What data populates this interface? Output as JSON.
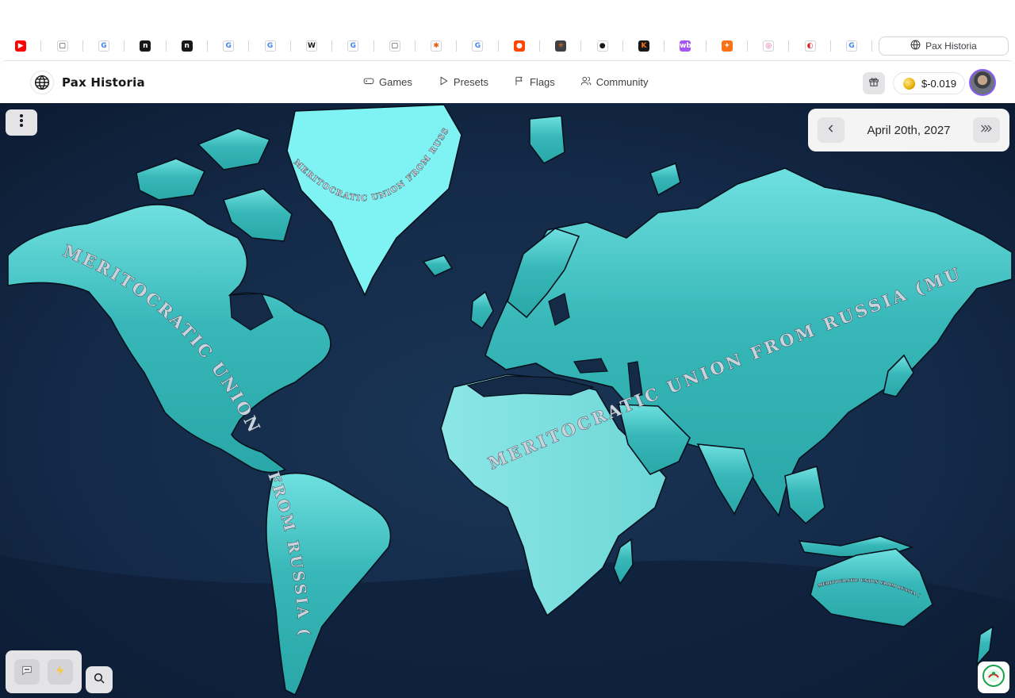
{
  "browser": {
    "tabs": [
      {
        "icon": "youtube-icon",
        "glyph": "▶",
        "bg": "#ff0000",
        "fg": "#ffffff"
      },
      {
        "icon": "app-square-icon",
        "glyph": "▢",
        "bg": "#ffffff",
        "fg": "#18181b"
      },
      {
        "icon": "google-icon",
        "glyph": "G",
        "bg": "#ffffff",
        "fg": "#4285f4"
      },
      {
        "icon": "n-logo-icon",
        "glyph": "n",
        "bg": "#18181b",
        "fg": "#ffffff"
      },
      {
        "icon": "n-logo-icon",
        "glyph": "n",
        "bg": "#18181b",
        "fg": "#ffffff"
      },
      {
        "icon": "google-icon",
        "glyph": "G",
        "bg": "#ffffff",
        "fg": "#4285f4"
      },
      {
        "icon": "google-icon",
        "glyph": "G",
        "bg": "#ffffff",
        "fg": "#4285f4"
      },
      {
        "icon": "wikipedia-icon",
        "glyph": "W",
        "bg": "#ffffff",
        "fg": "#18181b"
      },
      {
        "icon": "google-icon",
        "glyph": "G",
        "bg": "#ffffff",
        "fg": "#4285f4"
      },
      {
        "icon": "app-square-icon",
        "glyph": "▢",
        "bg": "#ffffff",
        "fg": "#18181b"
      },
      {
        "icon": "bug-icon",
        "glyph": "✱",
        "bg": "#ffffff",
        "fg": "#ea580c"
      },
      {
        "icon": "google-icon",
        "glyph": "G",
        "bg": "#ffffff",
        "fg": "#4285f4"
      },
      {
        "icon": "reddit-icon",
        "glyph": "●",
        "bg": "#ff4500",
        "fg": "#ffffff"
      },
      {
        "icon": "asterisk-icon",
        "glyph": "✳",
        "bg": "#3f3f46",
        "fg": "#f97316"
      },
      {
        "icon": "github-icon",
        "glyph": "●",
        "bg": "#ffffff",
        "fg": "#18181b"
      },
      {
        "icon": "k-logo-icon",
        "glyph": "K",
        "bg": "#18181b",
        "fg": "#f97316"
      },
      {
        "icon": "wb-logo-icon",
        "glyph": "wb",
        "bg": "#a855f7",
        "fg": "#ffffff"
      },
      {
        "icon": "bolt-app-icon",
        "glyph": "✦",
        "bg": "#f97316",
        "fg": "#ffffff"
      },
      {
        "icon": "pink-circle-icon",
        "glyph": "◎",
        "bg": "#ffffff",
        "fg": "#ec4899"
      },
      {
        "icon": "swirl-icon",
        "glyph": "◐",
        "bg": "#ffffff",
        "fg": "#dc2626"
      },
      {
        "icon": "google-icon",
        "glyph": "G",
        "bg": "#ffffff",
        "fg": "#4285f4"
      }
    ],
    "active_tab": {
      "icon": "globe-icon",
      "title": "Pax Historia"
    }
  },
  "header": {
    "brand": "Pax Historia",
    "nav": [
      {
        "name": "nav-games",
        "label": "Games",
        "icon": "gamepad-icon"
      },
      {
        "name": "nav-presets",
        "label": "Presets",
        "icon": "play-icon"
      },
      {
        "name": "nav-flags",
        "label": "Flags",
        "icon": "flag-icon"
      },
      {
        "name": "nav-community",
        "label": "Community",
        "icon": "users-icon"
      }
    ],
    "gift_icon": "gift-icon",
    "balance": "$-0.019",
    "accent_color": "#8b5cf6"
  },
  "map": {
    "date": "April 20th, 2027",
    "labels": {
      "main": "MERITOCRATIC UNION FROM RUSSIA (MUR)",
      "americas_north": "MERITOCRATIC UNION",
      "americas_south": "FROM RUSSIA (MUR)",
      "greenland": "MERITOCRATIC UNION FROM RUSSIA (MUR)",
      "eurasia": "MERITOCRATIC UNION FROM RUSSIA (MUR)",
      "australia": "MERITOCRATIC UNION FROM RUSSIA (MUR)"
    },
    "colors": {
      "land": "#3cbcbc",
      "land_light": "#7ee3e3",
      "ice": "#7ff3f3",
      "ocean": "#142a46",
      "ocean_deep": "#0d1a30",
      "border": "#0a1422"
    },
    "controls": {
      "menu_icon": "more-vertical-icon",
      "prev_icon": "chevron-left-icon",
      "fast_forward_icon": "double-chevron-right-icon",
      "chat_icon": "chat-bubble-icon",
      "bolt_icon": "lightning-icon",
      "search_icon": "search-icon",
      "badge_icon": "map-badge-icon"
    }
  }
}
